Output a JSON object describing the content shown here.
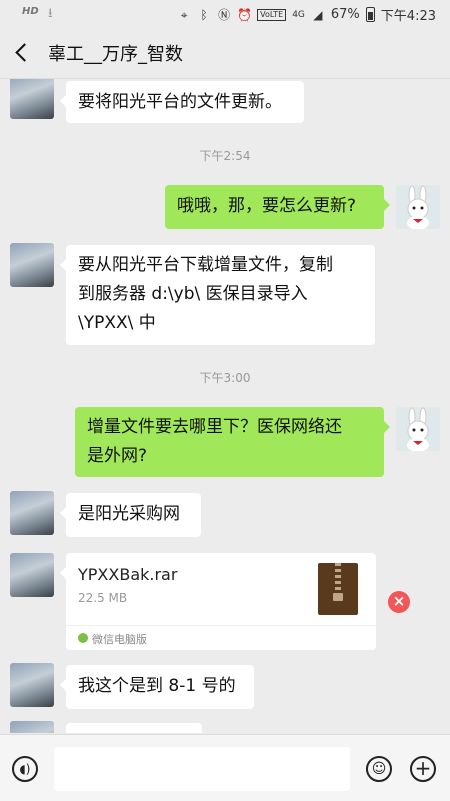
{
  "status_bar": {
    "hd": "HD",
    "volte": "VoLTE",
    "network": "4G",
    "battery": "67%",
    "time": "下午4:23",
    "icons": [
      "download-icon",
      "location-icon",
      "bluetooth-icon",
      "nfc-icon",
      "alarm-icon",
      "signal-icon",
      "battery-icon"
    ]
  },
  "header": {
    "title": "辜工__万序_智数"
  },
  "messages": [
    {
      "side": "left",
      "text": "要将阳光平台的文件更新。"
    },
    {
      "type": "time",
      "text": "下午2:54"
    },
    {
      "side": "right",
      "text": "哦哦，那，要怎么更新?"
    },
    {
      "side": "left",
      "lines": [
        "要从阳光平台下载增量文件，复制",
        "到服务器 d:\\yb\\ 医保目录导入",
        "\\YPXX\\ 中"
      ]
    },
    {
      "type": "time",
      "text": "下午3:00"
    },
    {
      "side": "right",
      "lines": [
        "增量文件要去哪里下？医保网络还",
        "是外网?"
      ]
    },
    {
      "side": "left",
      "text": "是阳光采购网"
    },
    {
      "side": "left",
      "type": "file",
      "file_name": "YPXXBak.rar",
      "file_size": "22.5 MB",
      "source": "微信电脑版",
      "status": "failed"
    },
    {
      "side": "left",
      "text": "我这个是到 8-1 号的"
    }
  ],
  "input": {
    "placeholder": ""
  },
  "colors": {
    "accent_bubble": "#a0e75a",
    "background": "#ececec",
    "error": "#f25656"
  }
}
